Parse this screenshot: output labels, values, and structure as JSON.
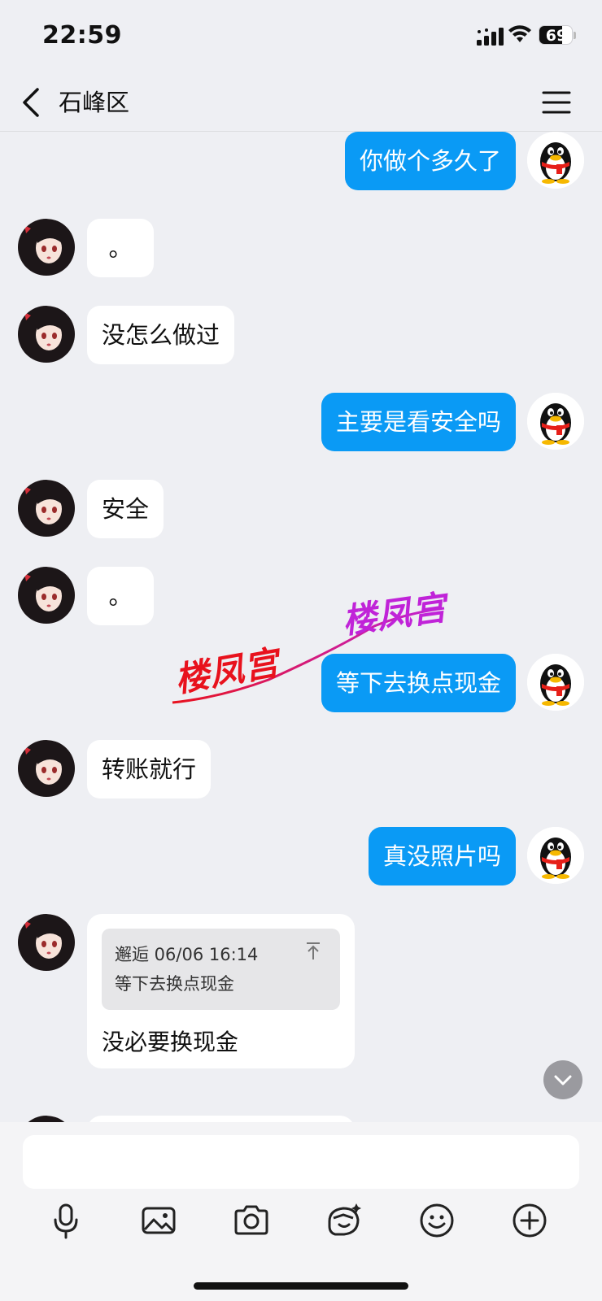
{
  "status_bar": {
    "time": "22:59",
    "battery": "69",
    "battery_level": 0.69
  },
  "header": {
    "title": "石峰区"
  },
  "messages": [
    {
      "side": "out",
      "text": "你做个多久了"
    },
    {
      "side": "in",
      "text": "。"
    },
    {
      "side": "in",
      "text": "没怎么做过"
    },
    {
      "side": "out",
      "text": "主要是看安全吗"
    },
    {
      "side": "in",
      "text": "安全"
    },
    {
      "side": "in",
      "text": "。"
    },
    {
      "side": "out",
      "text": "等下去换点现金"
    },
    {
      "side": "in",
      "text": "转账就行"
    },
    {
      "side": "out",
      "text": "真没照片吗"
    }
  ],
  "reply": {
    "quote_header": "邂逅 06/06 16:14",
    "quote_text": "等下去换点现金",
    "text": "没必要换现金"
  },
  "watermark": {
    "text": "楼凤宫",
    "colors": [
      "#e8121d",
      "#c023d8"
    ]
  },
  "composer": {
    "placeholder": ""
  },
  "icons": [
    "back-icon",
    "menu-icon",
    "microphone-icon",
    "image-icon",
    "camera-icon",
    "sticker-icon",
    "emoji-icon",
    "add-icon",
    "chevron-down-icon"
  ]
}
